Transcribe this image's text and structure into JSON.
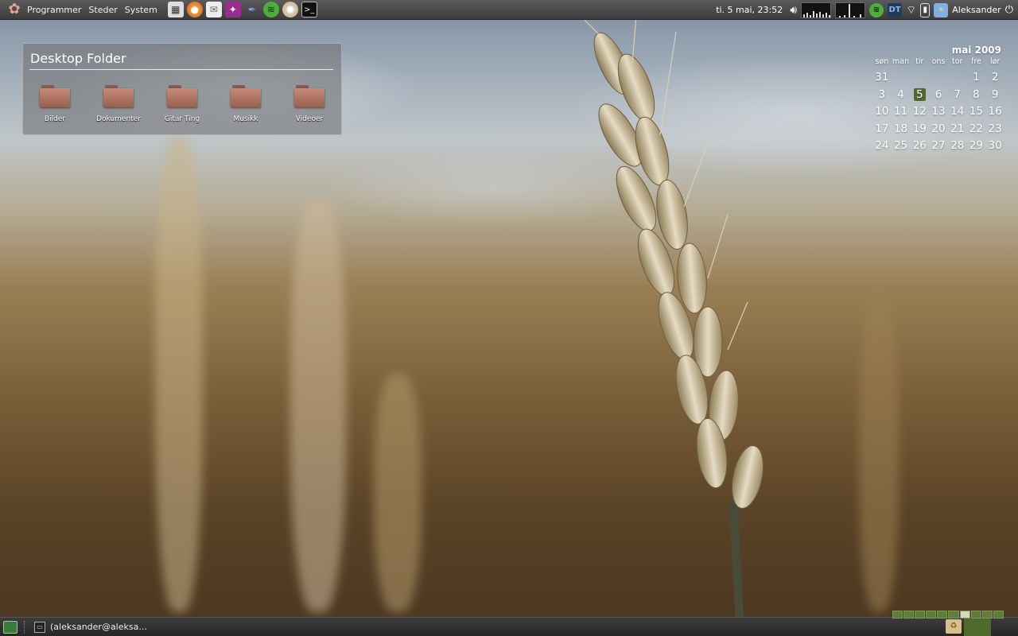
{
  "top_panel": {
    "menus": [
      "Programmer",
      "Steder",
      "System"
    ],
    "launchers": [
      "system-monitor-icon",
      "firefox-icon",
      "mail-icon",
      "image-viewer-icon",
      "pen-icon",
      "spotify-icon",
      "cd-burner-icon",
      "terminal-icon"
    ],
    "clock": "ti.  5 mai, 23:52",
    "tray": [
      "volume-icon",
      "network-graph",
      "cpu-graph",
      "spotify-tray-icon",
      "dt-icon",
      "wifi-icon",
      "battery-icon",
      "weather-icon"
    ],
    "dt_label": "DT",
    "user": "Aleksander"
  },
  "desktop_folder": {
    "title": "Desktop Folder",
    "items": [
      {
        "label": "Bilder"
      },
      {
        "label": "Dokumenter"
      },
      {
        "label": "Gitar Ting"
      },
      {
        "label": "Musikk"
      },
      {
        "label": "Videoer"
      }
    ]
  },
  "calendar": {
    "month": "mai 2009",
    "weekdays": [
      "søn",
      "man",
      "tir",
      "ons",
      "tor",
      "fre",
      "lør"
    ],
    "weeks": [
      [
        "31",
        "",
        "",
        "",
        "",
        "1",
        "2"
      ],
      [
        "3",
        "4",
        "5",
        "6",
        "7",
        "8",
        "9"
      ],
      [
        "10",
        "11",
        "12",
        "13",
        "14",
        "15",
        "16"
      ],
      [
        "17",
        "18",
        "19",
        "20",
        "21",
        "22",
        "23"
      ],
      [
        "24",
        "25",
        "26",
        "27",
        "28",
        "29",
        "30"
      ]
    ],
    "today": "5"
  },
  "bottom_panel": {
    "task_label": "(aleksander@aleksa...",
    "workspaces": 10,
    "active_workspace": 6
  },
  "colors": {
    "accent": "#4e6b2c",
    "panel": "#3c3c3c",
    "folder": "#b87866"
  }
}
